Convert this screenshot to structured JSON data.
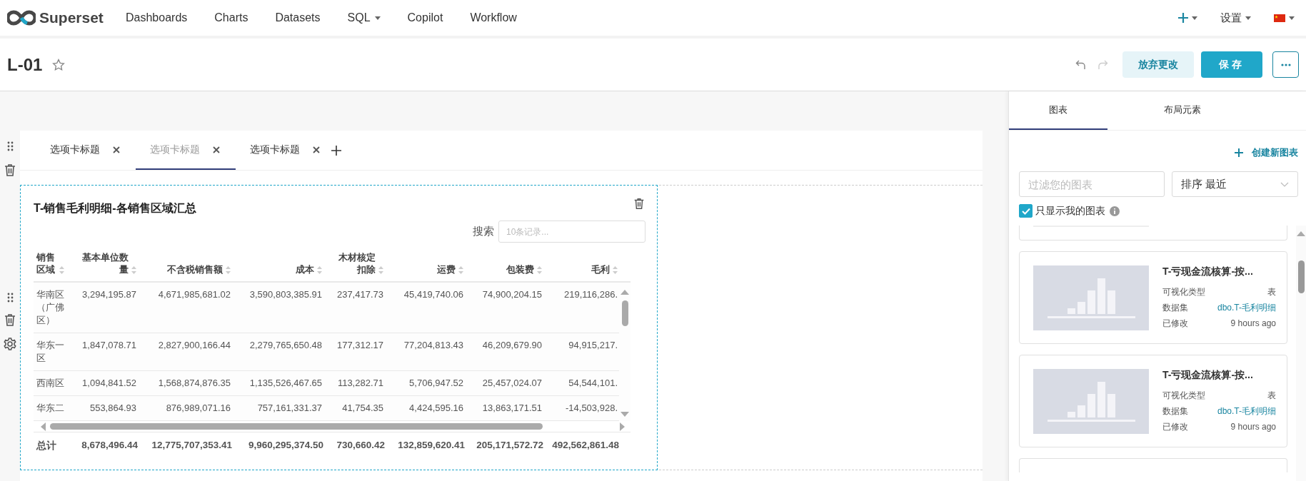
{
  "navbar": {
    "brand": "Superset",
    "items": [
      {
        "label": "Dashboards",
        "dropdown": false
      },
      {
        "label": "Charts",
        "dropdown": false
      },
      {
        "label": "Datasets",
        "dropdown": false
      },
      {
        "label": "SQL",
        "dropdown": true
      },
      {
        "label": "Copilot",
        "dropdown": false
      },
      {
        "label": "Workflow",
        "dropdown": false
      }
    ],
    "right": [
      {
        "kind": "plus"
      },
      {
        "kind": "text",
        "label": "设置"
      },
      {
        "kind": "flag"
      }
    ]
  },
  "header": {
    "title": "L-01",
    "starred": false,
    "undo_disabled": false,
    "redo_disabled": true,
    "buttons": [
      {
        "kind": "secondary",
        "label": "放弃更改"
      },
      {
        "kind": "primary",
        "label": "保存"
      },
      {
        "kind": "more"
      }
    ]
  },
  "dashboard": {
    "tabs": [
      {
        "label": "选项卡标题",
        "selected": false
      },
      {
        "label": "选项卡标题",
        "selected": true
      },
      {
        "label": "选项卡标题",
        "selected": false
      }
    ],
    "chart": {
      "title": "T-销售毛利明细-各销售区域汇总",
      "search_label": "搜索",
      "search_placeholder": "10条记录...",
      "table": {
        "columns": [
          "销售区域",
          "基本单位数量",
          "不含税销售额",
          "成本",
          "木材核定扣除",
          "运费",
          "包装费",
          "毛利"
        ],
        "rows": [
          [
            "华南区（广佛区）",
            "3,294,195.87",
            "4,671,985,681.02",
            "3,590,803,385.91",
            "237,417.73",
            "45,419,740.06",
            "74,900,204.15",
            "219,116,286."
          ],
          [
            "华东一区",
            "1,847,078.71",
            "2,827,900,166.44",
            "2,279,765,650.48",
            "177,312.17",
            "77,204,813.43",
            "46,209,679.90",
            "94,915,217."
          ],
          [
            "西南区",
            "1,094,841.52",
            "1,568,874,876.35",
            "1,135,526,467.65",
            "113,282.71",
            "5,706,947.52",
            "25,457,024.07",
            "54,544,101."
          ],
          [
            "华东二",
            "553,864.93",
            "876,989,071.16",
            "757,161,331.37",
            "41,754.35",
            "4,424,595.16",
            "13,863,171.51",
            "-14,503,928."
          ]
        ],
        "total": [
          "总计",
          "8,678,496.44",
          "12,775,707,353.41",
          "9,960,295,374.50",
          "730,660.42",
          "132,859,620.41",
          "205,171,572.72",
          "492,562,861.48"
        ]
      }
    }
  },
  "builder": {
    "tabs": [
      {
        "label": "图表",
        "selected": true
      },
      {
        "label": "布局元素",
        "selected": false
      }
    ],
    "create_label": "创建新图表",
    "filter_placeholder": "过滤您的图表",
    "sort_label": "排序",
    "sort_value": "最近",
    "only_mine": {
      "label": "只显示我的图表",
      "checked": true
    },
    "cards": [
      {
        "title": "T-亏现金流核算-按...",
        "meta": [
          {
            "label": "可视化类型",
            "value": "表",
            "kind": "text"
          },
          {
            "label": "数据集",
            "value": "dbo.T-毛利明细",
            "kind": "link"
          },
          {
            "label": "已修改",
            "value": "9 hours ago",
            "kind": "text"
          }
        ]
      },
      {
        "title": "T-亏现金流核算-按...",
        "meta": [
          {
            "label": "可视化类型",
            "value": "表",
            "kind": "text"
          },
          {
            "label": "数据集",
            "value": "dbo.T-毛利明细",
            "kind": "link"
          },
          {
            "label": "已修改",
            "value": "9 hours ago",
            "kind": "text"
          }
        ]
      }
    ]
  }
}
